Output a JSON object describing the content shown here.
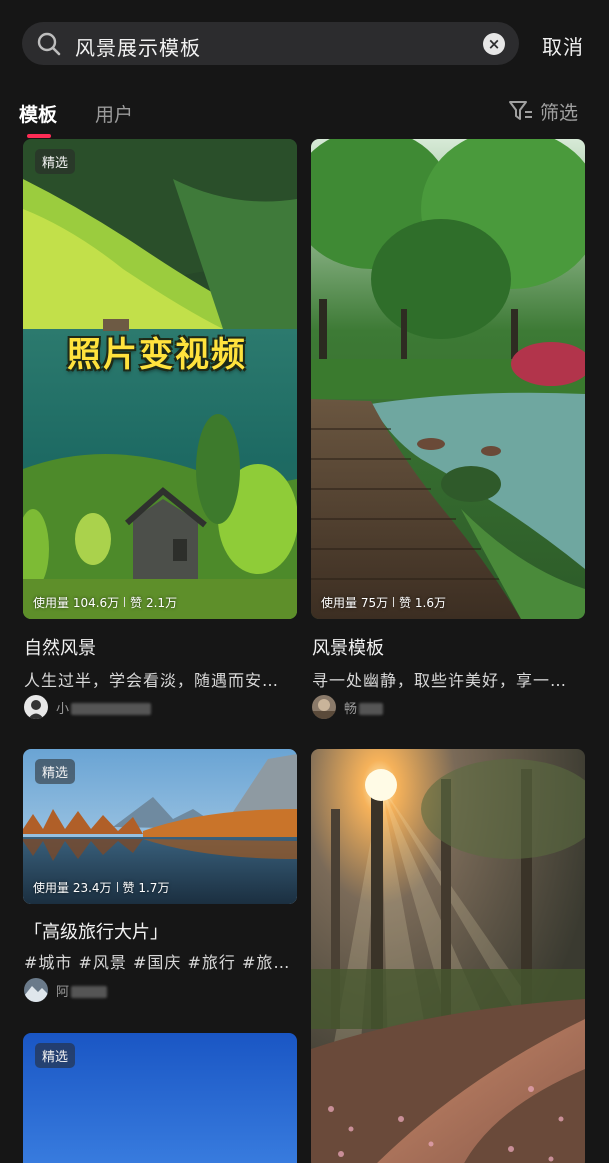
{
  "search": {
    "query": "风景展示模板",
    "clear_icon": "×",
    "cancel_label": "取消"
  },
  "tabs": [
    {
      "label": "模板"
    },
    {
      "label": "用户"
    }
  ],
  "filter": {
    "label": "筛选"
  },
  "cards": [
    {
      "badge": "精选",
      "overlay_title": "照片变视频",
      "stats_usage": "使用量 104.6万",
      "stats_likes": "赞 2.1万",
      "title": "自然风景",
      "desc": "人生过半，学会看淡，随遇而安…",
      "author": "小"
    },
    {
      "stats_usage": "使用量 75万",
      "stats_likes": "赞 1.6万",
      "title": "风景模板",
      "desc": "寻一处幽静，取些许美好，享一…",
      "author": "畅"
    },
    {
      "badge": "精选",
      "stats_usage": "使用量 23.4万",
      "stats_likes": "赞 1.7万",
      "title": "「高级旅行大片」",
      "desc": "#城市 #风景 #国庆 #旅行 #旅…",
      "author": "阿"
    },
    {
      "badge": "精选"
    },
    {}
  ],
  "colors": {
    "background": "#161616",
    "accent": "#fe2c55",
    "overlay_title": "#ffe23d"
  }
}
